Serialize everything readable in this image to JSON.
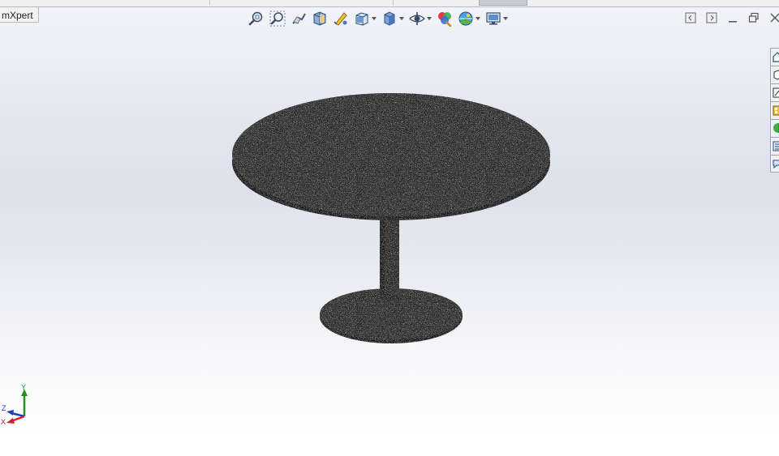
{
  "command_manager": {
    "tab_label": "mXpert"
  },
  "view_toolbar": {
    "buttons": [
      {
        "id": "zoom-to-fit",
        "icon": "zoom-to-fit-icon"
      },
      {
        "id": "zoom-to-area",
        "icon": "zoom-to-area-icon"
      },
      {
        "id": "previous-view",
        "icon": "previous-view-icon"
      },
      {
        "id": "section-view",
        "icon": "section-view-icon"
      },
      {
        "id": "dynamic-annotation",
        "icon": "dynamic-annotation-icon"
      },
      {
        "id": "view-orientation",
        "icon": "view-orientation-icon",
        "dropdown": true
      },
      {
        "id": "display-style",
        "icon": "display-style-icon",
        "dropdown": true
      },
      {
        "id": "hide-show-items",
        "icon": "hide-show-items-icon",
        "dropdown": true
      },
      {
        "id": "edit-appearance",
        "icon": "edit-appearance-icon"
      },
      {
        "id": "apply-scene",
        "icon": "apply-scene-icon",
        "dropdown": true
      },
      {
        "id": "view-settings",
        "icon": "view-settings-icon",
        "dropdown": true
      }
    ]
  },
  "window_controls": [
    "tile-left-icon",
    "tile-right-icon",
    "minimize-icon",
    "restore-icon",
    "close-icon"
  ],
  "task_pane": {
    "tabs": [
      {
        "id": "resources",
        "icon": "home-icon"
      },
      {
        "id": "design-library",
        "icon": "design-library-icon"
      },
      {
        "id": "file-explorer",
        "icon": "file-explorer-icon"
      },
      {
        "id": "view-palette",
        "icon": "view-palette-icon"
      },
      {
        "id": "appearances",
        "icon": "appearances-icon"
      },
      {
        "id": "custom-properties",
        "icon": "custom-properties-icon"
      },
      {
        "id": "forum",
        "icon": "forum-icon"
      }
    ]
  },
  "triad": {
    "x_label": "X",
    "y_label": "Y",
    "z_label": "Z"
  },
  "colors": {
    "model_fill": "#2c2c2c",
    "axis_x": "#d0202a",
    "axis_y": "#2a8a2a",
    "axis_z": "#2040c0"
  }
}
